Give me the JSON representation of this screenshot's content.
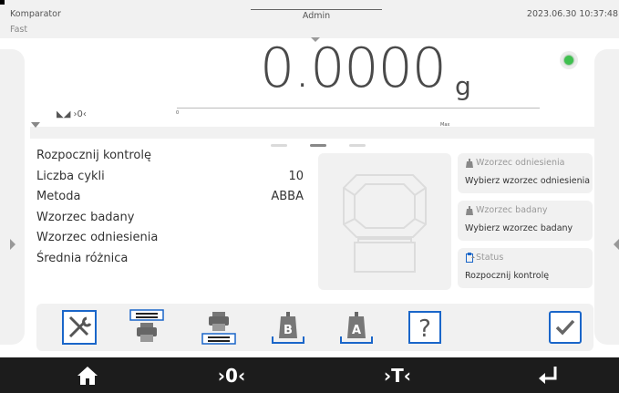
{
  "status_bar": {
    "mode_name": "Komparator",
    "mode_sub": "Fast",
    "user_name": "Admin",
    "datetime": "2023.06.30 10:37:48"
  },
  "weighing": {
    "value": "0.0000",
    "unit": "g",
    "stable_color": "#3fc04f",
    "zero_indicator": "◣◢ ›0‹",
    "bar_min_label": "0",
    "bar_max_label": "Max",
    "bar_fill_fraction": 0
  },
  "page_indicator": {
    "count": 3,
    "active_index": 1
  },
  "info_list": [
    {
      "label": "Rozpocznij kontrolę",
      "value": ""
    },
    {
      "label": "Liczba cykli",
      "value": "10"
    },
    {
      "label": "Metoda",
      "value": "ABBA"
    },
    {
      "label": "Wzorzec badany",
      "value": ""
    },
    {
      "label": "Wzorzec odniesienia",
      "value": ""
    },
    {
      "label": "Średnia różnica",
      "value": ""
    }
  ],
  "cards": {
    "reference": {
      "title": "Wzorzec odniesienia",
      "value": "Wybierz wzorzec odniesienia",
      "icon": "weight-icon"
    },
    "tested": {
      "title": "Wzorzec badany",
      "value": "Wybierz wzorzec badany",
      "icon": "weight-icon"
    },
    "status": {
      "title": "Status",
      "value": "Rozpocznij kontrolę",
      "icon": "clipboard-icon"
    }
  },
  "toolbar": {
    "accent_color": "#1a66c9",
    "buttons": [
      {
        "name": "settings-tools",
        "icon": "tools-icon"
      },
      {
        "name": "header-print",
        "icon": "header-printer-icon"
      },
      {
        "name": "footer-print",
        "icon": "footer-printer-icon"
      },
      {
        "name": "tested-standard",
        "icon": "weight-b-icon",
        "letter": "B"
      },
      {
        "name": "reference-standard",
        "icon": "weight-a-icon",
        "letter": "A"
      },
      {
        "name": "help",
        "icon": "help-icon",
        "glyph": "?"
      },
      {
        "name": "confirm",
        "icon": "check-icon"
      }
    ]
  },
  "bottom_nav": {
    "zero_label": "›0‹",
    "tare_label": "›T‹",
    "items": [
      "home-icon",
      "zero-icon",
      "tare-icon",
      "enter-icon"
    ]
  }
}
